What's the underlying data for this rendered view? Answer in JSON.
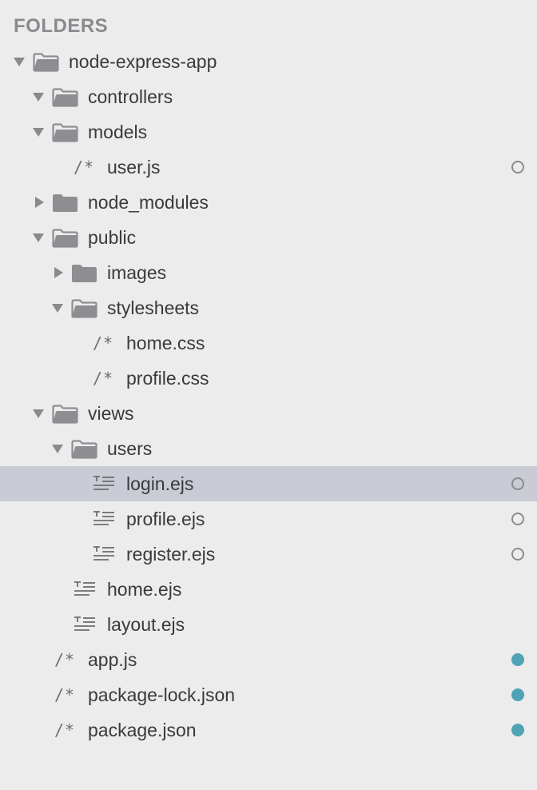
{
  "header": {
    "title": "FOLDERS"
  },
  "colors": {
    "background": "#ececed",
    "selection": "#c9ccd4",
    "folder": "#8e8e92",
    "status_new": "#4fa3b5",
    "status_modified_ring": "#8c8c90"
  },
  "tree": [
    {
      "label": "node-express-app",
      "depth": 0,
      "type": "folder",
      "expanded": true,
      "icon": "folder-open-icon",
      "status": ""
    },
    {
      "label": "controllers",
      "depth": 1,
      "type": "folder",
      "expanded": true,
      "icon": "folder-open-icon",
      "status": ""
    },
    {
      "label": "models",
      "depth": 1,
      "type": "folder",
      "expanded": true,
      "icon": "folder-open-icon",
      "status": ""
    },
    {
      "label": "user.js",
      "depth": 2,
      "type": "file",
      "icon": "comment-file-icon",
      "glyph": "/*",
      "status": "modified"
    },
    {
      "label": "node_modules",
      "depth": 1,
      "type": "folder",
      "expanded": false,
      "icon": "folder-closed-icon",
      "status": ""
    },
    {
      "label": "public",
      "depth": 1,
      "type": "folder",
      "expanded": true,
      "icon": "folder-open-icon",
      "status": ""
    },
    {
      "label": "images",
      "depth": 2,
      "type": "folder",
      "expanded": false,
      "icon": "folder-closed-icon",
      "status": ""
    },
    {
      "label": "stylesheets",
      "depth": 2,
      "type": "folder",
      "expanded": true,
      "icon": "folder-open-icon",
      "status": ""
    },
    {
      "label": "home.css",
      "depth": 3,
      "type": "file",
      "icon": "comment-file-icon",
      "glyph": "/*",
      "status": ""
    },
    {
      "label": "profile.css",
      "depth": 3,
      "type": "file",
      "icon": "comment-file-icon",
      "glyph": "/*",
      "status": ""
    },
    {
      "label": "views",
      "depth": 1,
      "type": "folder",
      "expanded": true,
      "icon": "folder-open-icon",
      "status": ""
    },
    {
      "label": "users",
      "depth": 2,
      "type": "folder",
      "expanded": true,
      "icon": "folder-open-icon",
      "status": ""
    },
    {
      "label": "login.ejs",
      "depth": 3,
      "type": "file",
      "icon": "text-file-icon",
      "status": "modified",
      "selected": true
    },
    {
      "label": "profile.ejs",
      "depth": 3,
      "type": "file",
      "icon": "text-file-icon",
      "status": "modified"
    },
    {
      "label": "register.ejs",
      "depth": 3,
      "type": "file",
      "icon": "text-file-icon",
      "status": "modified"
    },
    {
      "label": "home.ejs",
      "depth": 2,
      "type": "file",
      "icon": "text-file-icon",
      "status": ""
    },
    {
      "label": "layout.ejs",
      "depth": 2,
      "type": "file",
      "icon": "text-file-icon",
      "status": ""
    },
    {
      "label": "app.js",
      "depth": 1,
      "type": "file",
      "icon": "comment-file-icon",
      "glyph": "/*",
      "status": "untracked"
    },
    {
      "label": "package-lock.json",
      "depth": 1,
      "type": "file",
      "icon": "comment-file-icon",
      "glyph": "/*",
      "status": "untracked"
    },
    {
      "label": "package.json",
      "depth": 1,
      "type": "file",
      "icon": "comment-file-icon",
      "glyph": "/*",
      "status": "untracked"
    }
  ]
}
